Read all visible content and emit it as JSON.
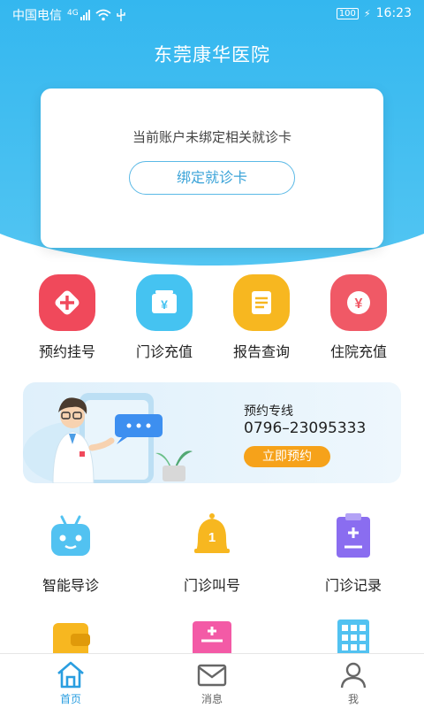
{
  "status_bar": {
    "carrier": "中国电信",
    "network": "4G",
    "battery": "100",
    "time": "16:23"
  },
  "header": {
    "title": "东莞康华医院"
  },
  "card": {
    "message": "当前账户未绑定相关就诊卡",
    "bind_button": "绑定就诊卡"
  },
  "quick_actions": [
    {
      "label": "预约挂号",
      "icon": "plus-diamond-icon",
      "color": "#f0495b"
    },
    {
      "label": "门诊充值",
      "icon": "yen-card-icon",
      "color": "#45c3f1"
    },
    {
      "label": "报告查询",
      "icon": "report-list-icon",
      "color": "#f7b720"
    },
    {
      "label": "住院充值",
      "icon": "yen-circle-icon",
      "color": "#f05966"
    }
  ],
  "banner": {
    "title": "预约专线",
    "phone": "0796–23095333",
    "button": "立即预约"
  },
  "services": [
    {
      "label": "智能导诊",
      "icon": "robot-icon",
      "color": "#52c2f1"
    },
    {
      "label": "门诊叫号",
      "icon": "bell-icon",
      "color": "#f7b720",
      "badge": "1"
    },
    {
      "label": "门诊记录",
      "icon": "clipboard-icon",
      "color": "#8a6df0"
    }
  ],
  "services_row2": [
    {
      "icon": "wallet-icon",
      "color": "#f7b720"
    },
    {
      "icon": "document-icon",
      "color": "#f35aa6"
    },
    {
      "icon": "building-icon",
      "color": "#52c2f1"
    }
  ],
  "tabs": [
    {
      "label": "首页",
      "icon": "home-icon",
      "active": true
    },
    {
      "label": "消息",
      "icon": "mail-icon",
      "active": false
    },
    {
      "label": "我",
      "icon": "user-icon",
      "active": false
    }
  ],
  "colors": {
    "primary": "#34b7ef",
    "active_tab": "#2a9ee0",
    "inactive_tab": "#666666",
    "orange": "#f6a21a"
  }
}
